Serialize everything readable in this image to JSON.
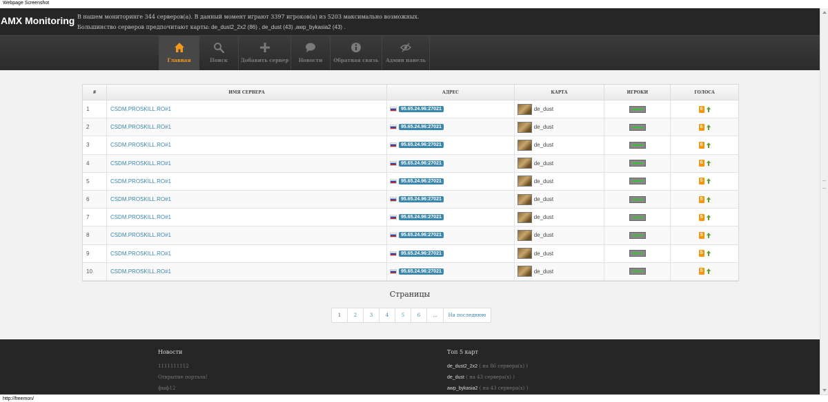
{
  "window": {
    "caption": "Webpage Screenshot",
    "status_url": "http://freemon/"
  },
  "header": {
    "logo": "AMX Monitoring",
    "stats_line": "В нашем мониторинге 344 серверов(а). В данный момент играют 3397 игроков(а) из 5203 максимально возможных.",
    "maps_prefix": "Большинство серверов предпочитают карты:",
    "maps_list": " de_dust2_2x2 (86) , de_dust (43) ,awp_bykasia2 (43) ."
  },
  "nav": {
    "items": [
      {
        "label": "Главная",
        "icon": "home-icon",
        "active": true
      },
      {
        "label": "Поиск",
        "icon": "search-icon",
        "active": false
      },
      {
        "label": "Добавить сервер",
        "icon": "plus-icon",
        "active": false
      },
      {
        "label": "Новости",
        "icon": "comment-icon",
        "active": false
      },
      {
        "label": "Обратная связь",
        "icon": "info-icon",
        "active": false
      },
      {
        "label": "Админ панель",
        "icon": "eye-slash-icon",
        "active": false
      }
    ]
  },
  "table": {
    "headers": {
      "num": "#",
      "name": "Имя сервера",
      "address": "Адрес",
      "map": "Карта",
      "players": "Игроки",
      "votes": "Голоса"
    },
    "rows": [
      {
        "num": "1",
        "name": "CSDM.PROSKILL.RO#1",
        "address": "95.65.24.96:27021",
        "map": "de_dust",
        "votes": "6"
      },
      {
        "num": "2",
        "name": "CSDM.PROSKILL.RO#1",
        "address": "95.65.24.96:27021",
        "map": "de_dust",
        "votes": "6"
      },
      {
        "num": "3",
        "name": "CSDM.PROSKILL.RO#1",
        "address": "95.65.24.96:27021",
        "map": "de_dust",
        "votes": "6"
      },
      {
        "num": "4",
        "name": "CSDM.PROSKILL.RO#1",
        "address": "95.65.24.96:27021",
        "map": "de_dust",
        "votes": "6"
      },
      {
        "num": "5",
        "name": "CSDM.PROSKILL.RO#1",
        "address": "95.65.24.96:27021",
        "map": "de_dust",
        "votes": "5"
      },
      {
        "num": "6",
        "name": "CSDM.PROSKILL.RO#1",
        "address": "95.65.24.96:27021",
        "map": "de_dust",
        "votes": "5"
      },
      {
        "num": "7",
        "name": "CSDM.PROSKILL.RO#1",
        "address": "95.65.24.96:27021",
        "map": "de_dust",
        "votes": "5"
      },
      {
        "num": "8",
        "name": "CSDM.PROSKILL.RO#1",
        "address": "95.65.24.96:27021",
        "map": "de_dust",
        "votes": "5"
      },
      {
        "num": "9",
        "name": "CSDM.PROSKILL.RO#1",
        "address": "95.65.24.96:27021",
        "map": "de_dust",
        "votes": "5"
      },
      {
        "num": "10",
        "name": "CSDM.PROSKILL.RO#1",
        "address": "95.65.24.96:27021",
        "map": "de_dust",
        "votes": "5"
      }
    ]
  },
  "pagination": {
    "title": "Страницы",
    "pages": [
      "1",
      "2",
      "3",
      "4",
      "5",
      "6",
      "...",
      "На последнюю"
    ]
  },
  "footer": {
    "news_title": "Новости",
    "news": [
      "1111111112",
      "Открытие портала!",
      "фыф12"
    ],
    "top_title": "Топ 5 карт",
    "top_maps": [
      {
        "name": "de_dust2_2x2",
        "note": " ( на 86 сервера(х) )"
      },
      {
        "name": "de_dust",
        "note": " ( на 43 сервера(х) )"
      },
      {
        "name": "awp_bykasia2",
        "note": " ( на 43 сервера(х) )"
      }
    ]
  },
  "colors": {
    "accent": "#f49a1a",
    "link": "#3a87ad",
    "header_bg": "#262626",
    "vote_badge": "#f89406",
    "vote_up": "#5aa02c"
  }
}
